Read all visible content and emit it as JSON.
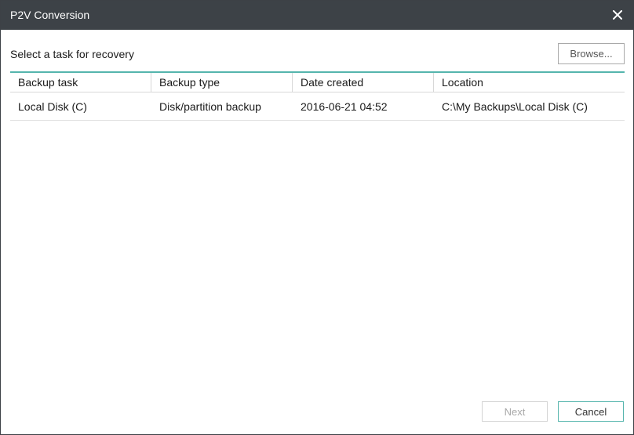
{
  "window": {
    "title": "P2V Conversion"
  },
  "content": {
    "prompt": "Select a task for recovery",
    "browse_label": "Browse..."
  },
  "table": {
    "headers": [
      "Backup task",
      "Backup type",
      "Date created",
      "Location"
    ],
    "rows": [
      [
        "Local Disk (C)",
        "Disk/partition backup",
        "2016-06-21 04:52",
        "C:\\My Backups\\Local Disk (C)"
      ]
    ]
  },
  "footer": {
    "next_label": "Next",
    "cancel_label": "Cancel"
  },
  "colors": {
    "titlebar": "#3d4247",
    "accent": "#55b5ad"
  }
}
